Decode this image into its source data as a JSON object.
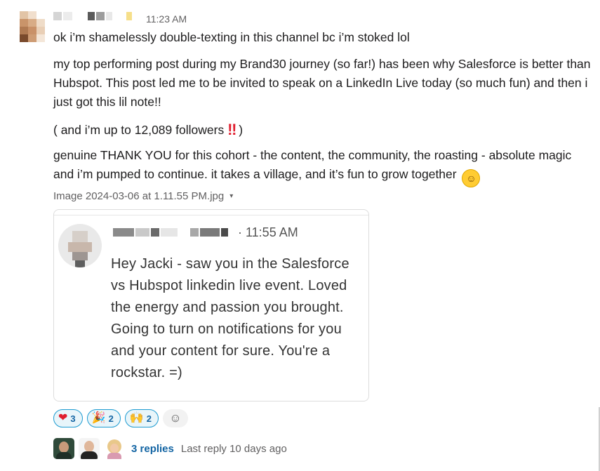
{
  "message": {
    "time": "11:23 AM",
    "line1": "ok i’m shamelessly double-texting in this channel bc i’m stoked lol",
    "para2": "my top performing post during my Brand30 journey (so far!) has been why Salesforce is better than Hubspot. This post led me to be invited to speak on a LinkedIn Live today (so much fun) and then i just got this lil note!!",
    "para3_start": "( and i’m up to 12,089 followers ",
    "para3_bangs": "‼",
    "para3_end": " )",
    "para4": "genuine THANK YOU for this cohort - the content, the community, the roasting - absolute magic and i’m pumped to continue. it takes a village, and it’s fun to grow together",
    "para4_emoji": "relieved-smile-emoji"
  },
  "file": {
    "name": "Image 2024-03-06 at 1.11.55 PM.jpg",
    "caret": "▾"
  },
  "attachment": {
    "time": "· 11:55 AM",
    "text": "Hey Jacki - saw you in the Salesforce vs Hubspot linkedin live event. Loved the energy and passion you brought. Going to turn on notifications for you and your content for sure. You're a rockstar. =)"
  },
  "reactions": [
    {
      "emoji": "❤",
      "count": "3",
      "icon": "heart-icon"
    },
    {
      "emoji": "🎉",
      "count": "2",
      "icon": "party-popper-icon"
    },
    {
      "emoji": "🙌",
      "count": "2",
      "icon": "raised-hands-icon"
    }
  ],
  "add_reaction_icon": "☺",
  "thread": {
    "reply_count": "3 replies",
    "last_reply": "Last reply 10 days ago"
  },
  "colors": {
    "link": "#1264a3",
    "reaction_border": "#1d9bd1",
    "reaction_bg": "#e8f5fa",
    "alert_red": "#e01e2e",
    "muted": "#616061"
  }
}
